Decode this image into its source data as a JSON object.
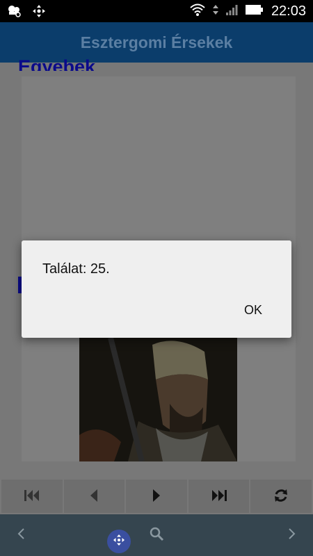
{
  "status_bar": {
    "time": "22:03"
  },
  "app_bar": {
    "title": "Esztergomi Érsekek"
  },
  "content": {
    "section_heading": "Egyebek"
  },
  "dialog": {
    "message": "Találat: 25.",
    "ok_label": "OK"
  },
  "toolbar": {
    "buttons": [
      "first-page-icon",
      "previous-icon",
      "next-icon",
      "last-page-icon",
      "refresh-icon"
    ]
  },
  "nav_bar": {
    "items": [
      "back-chevron-icon",
      "move-icon",
      "search-icon",
      "forward-chevron-icon"
    ]
  },
  "colors": {
    "app_bar": "#0b3d6b",
    "heading": "#0a0a8a",
    "dialog_bg": "#efefef",
    "nav_bar": "#35454f",
    "fab": "#3a4fa0"
  }
}
